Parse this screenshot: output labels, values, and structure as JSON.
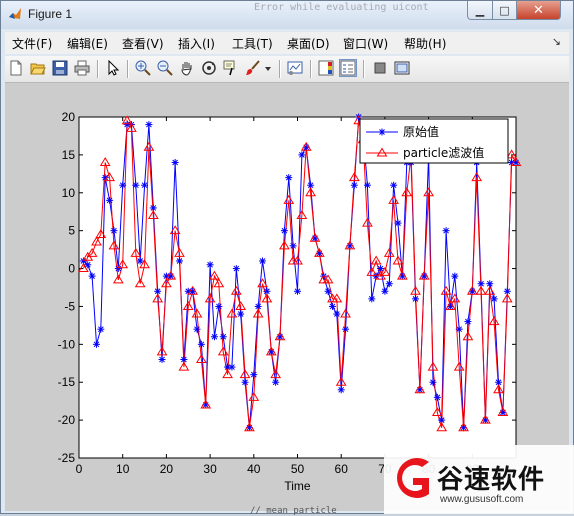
{
  "window": {
    "title": "Figure 1",
    "controls": {
      "minimize": "▁",
      "maximize": "□",
      "close": "✕"
    }
  },
  "menu": {
    "items": [
      "文件(F)",
      "编辑(E)",
      "查看(V)",
      "插入(I)",
      "工具(T)",
      "桌面(D)",
      "窗口(W)",
      "帮助(H)"
    ],
    "overflow_arrow": "↘"
  },
  "toolbar": {
    "icons": [
      "new-figure-icon",
      "open-file-icon",
      "save-icon",
      "print-icon",
      "pointer-icon",
      "zoom-in-icon",
      "zoom-out-icon",
      "pan-hand-icon",
      "rotate-3d-icon",
      "data-cursor-icon",
      "brush-icon",
      "brush-dropdown-icon",
      "link-plot-icon",
      "colorbar-icon",
      "legend-icon",
      "hide-plot-tools-icon",
      "show-plot-tools-icon"
    ]
  },
  "ghost_text": {
    "top": "Error while evaluating uicont",
    "bottom": "// mean particle"
  },
  "watermark": {
    "brand": "谷速软件",
    "url": "www.gususoft.com",
    "color": "#e8141b"
  },
  "chart_data": {
    "type": "line",
    "xlabel": "Time",
    "ylabel": "",
    "title": "",
    "xlim": [
      0,
      100
    ],
    "ylim": [
      -25,
      20
    ],
    "xticks": [
      0,
      10,
      20,
      30,
      40,
      50,
      60,
      70,
      80,
      90
    ],
    "yticks": [
      20,
      15,
      10,
      5,
      0,
      -5,
      -10,
      -15,
      -20,
      -25
    ],
    "legend_position": "top-right",
    "series": [
      {
        "name": "原始值",
        "color": "#0000ff",
        "marker": "*",
        "x": [
          1,
          2,
          3,
          4,
          5,
          6,
          7,
          8,
          9,
          10,
          11,
          12,
          13,
          14,
          15,
          16,
          17,
          18,
          19,
          20,
          21,
          22,
          23,
          24,
          25,
          26,
          27,
          28,
          29,
          30,
          31,
          32,
          33,
          34,
          35,
          36,
          37,
          38,
          39,
          40,
          41,
          42,
          43,
          44,
          45,
          46,
          47,
          48,
          49,
          50,
          51,
          52,
          53,
          54,
          55,
          56,
          57,
          58,
          59,
          60,
          61,
          62,
          63,
          64,
          65,
          66,
          67,
          68,
          69,
          70,
          71,
          72,
          73,
          74,
          75,
          76,
          77,
          78,
          79,
          80,
          81,
          82,
          83,
          84,
          85,
          86,
          87,
          88,
          89,
          90,
          91,
          92,
          93,
          94,
          95,
          96,
          97,
          98,
          99,
          100
        ],
        "y": [
          1,
          0.5,
          -1,
          -10,
          -8,
          12,
          9,
          5,
          0,
          11,
          19,
          19,
          11,
          1,
          11,
          19,
          8,
          -3,
          -12,
          -1,
          -1,
          14,
          1,
          -12,
          -3,
          -3,
          -8,
          -10,
          -18,
          0.5,
          -9,
          -5,
          -9,
          -13,
          -13,
          0,
          -6,
          -15,
          -21,
          -14,
          -5,
          1,
          -3,
          -11,
          -15,
          -9,
          5,
          12,
          3,
          -3,
          15,
          16,
          11,
          4,
          2,
          -1,
          -3,
          -5,
          -6,
          -16,
          -8,
          3,
          11,
          20,
          18,
          11,
          -4,
          -1,
          0,
          -3,
          -2,
          11,
          6,
          -1,
          14,
          14,
          -4,
          -16,
          -1,
          15,
          -15,
          -17,
          -20,
          5,
          -5,
          -1,
          -8,
          -21,
          -7,
          -3,
          14,
          -2,
          -20,
          -2,
          -4,
          -15,
          -19,
          -3,
          14,
          14
        ],
        "noise_marker": "dashed"
      },
      {
        "name": "particle滤波值",
        "color": "#ff0000",
        "marker": "triangle",
        "x": [
          1,
          2,
          3,
          4,
          5,
          6,
          7,
          8,
          9,
          10,
          11,
          12,
          13,
          14,
          15,
          16,
          17,
          18,
          19,
          20,
          21,
          22,
          23,
          24,
          25,
          26,
          27,
          28,
          29,
          30,
          31,
          32,
          33,
          34,
          35,
          36,
          37,
          38,
          39,
          40,
          41,
          42,
          43,
          44,
          45,
          46,
          47,
          48,
          49,
          50,
          51,
          52,
          53,
          54,
          55,
          56,
          57,
          58,
          59,
          60,
          61,
          62,
          63,
          64,
          65,
          66,
          67,
          68,
          69,
          70,
          71,
          72,
          73,
          74,
          75,
          76,
          77,
          78,
          79,
          80,
          81,
          82,
          83,
          84,
          85,
          86,
          87,
          88,
          89,
          90,
          91,
          92,
          93,
          94,
          95,
          96,
          97,
          98,
          99,
          100
        ],
        "y": [
          0,
          1.5,
          2,
          3.5,
          4.5,
          14,
          12,
          3,
          -1.5,
          0.5,
          19.5,
          18.5,
          2,
          -2,
          0.5,
          16,
          7,
          -4,
          -11,
          -2,
          -1,
          5,
          2,
          -13,
          -5,
          -3,
          -6,
          -12,
          -18,
          -4,
          -1,
          -2,
          -11,
          -14,
          -6,
          -3,
          -5,
          -14,
          -21,
          -17,
          -6,
          -2,
          -4,
          -11,
          -14,
          -9,
          3,
          9,
          1,
          1,
          7,
          16,
          10,
          4,
          2,
          -1.5,
          -1.5,
          -4,
          -4,
          -15,
          -6,
          3,
          12,
          19.5,
          17,
          6,
          -0.5,
          1,
          -1,
          -0.5,
          2,
          9,
          1,
          -1,
          10,
          15,
          -3,
          -16,
          -1,
          10,
          -13,
          -19,
          -21,
          -3,
          -5,
          -4,
          -13,
          -21,
          -9,
          -3,
          12,
          -3,
          -20,
          -3,
          -7,
          -16,
          -19,
          -4,
          15,
          14
        ]
      }
    ]
  }
}
